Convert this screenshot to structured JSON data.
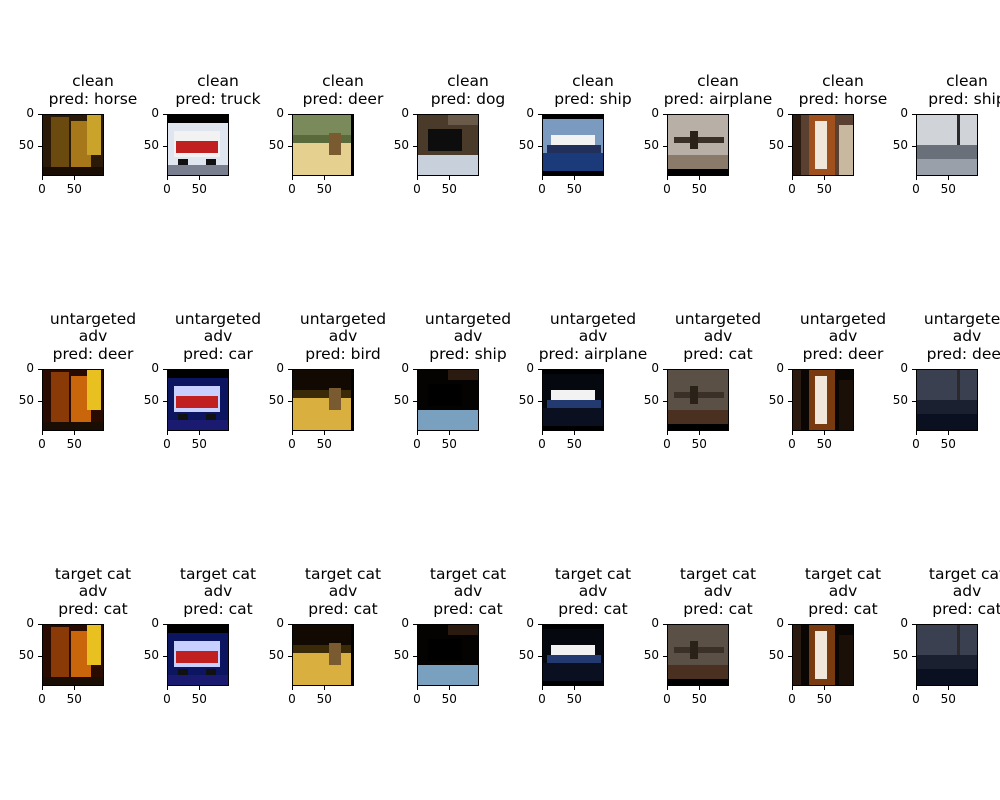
{
  "chart_data": {
    "type": "image-grid",
    "rows": [
      {
        "row_label": "clean",
        "panels": [
          {
            "title_lines": [
              "clean",
              "pred: horse"
            ],
            "image": "horse-dark"
          },
          {
            "title_lines": [
              "clean",
              "pred: truck"
            ],
            "image": "fire-truck"
          },
          {
            "title_lines": [
              "clean",
              "pred: deer"
            ],
            "image": "deer-field"
          },
          {
            "title_lines": [
              "clean",
              "pred: dog"
            ],
            "image": "black-dog"
          },
          {
            "title_lines": [
              "clean",
              "pred: ship"
            ],
            "image": "ship-sea"
          },
          {
            "title_lines": [
              "clean",
              "pred: airplane"
            ],
            "image": "airplane-runway"
          },
          {
            "title_lines": [
              "clean",
              "pred: horse"
            ],
            "image": "horse-face"
          },
          {
            "title_lines": [
              "clean",
              "pred: ship"
            ],
            "image": "ship-harbor"
          }
        ]
      },
      {
        "row_label": "untargeted adv",
        "panels": [
          {
            "title_lines": [
              "untargeted",
              "adv",
              "pred: deer"
            ],
            "image": "horse-dark"
          },
          {
            "title_lines": [
              "untargeted",
              "adv",
              "pred: car"
            ],
            "image": "fire-truck"
          },
          {
            "title_lines": [
              "untargeted",
              "adv",
              "pred: bird"
            ],
            "image": "deer-field"
          },
          {
            "title_lines": [
              "untargeted",
              "adv",
              "pred: ship"
            ],
            "image": "black-dog"
          },
          {
            "title_lines": [
              "untargeted",
              "adv",
              "pred: airplane"
            ],
            "image": "ship-sea"
          },
          {
            "title_lines": [
              "untargeted",
              "adv",
              "pred: cat"
            ],
            "image": "airplane-runway"
          },
          {
            "title_lines": [
              "untargeted",
              "adv",
              "pred: deer"
            ],
            "image": "horse-face"
          },
          {
            "title_lines": [
              "untargeted",
              "adv",
              "pred: deer"
            ],
            "image": "ship-harbor"
          }
        ]
      },
      {
        "row_label": "target cat adv",
        "panels": [
          {
            "title_lines": [
              "target cat",
              "adv",
              "pred: cat"
            ],
            "image": "horse-dark"
          },
          {
            "title_lines": [
              "target cat",
              "adv",
              "pred: cat"
            ],
            "image": "fire-truck"
          },
          {
            "title_lines": [
              "target cat",
              "adv",
              "pred: cat"
            ],
            "image": "deer-field"
          },
          {
            "title_lines": [
              "target cat",
              "adv",
              "pred: cat"
            ],
            "image": "black-dog"
          },
          {
            "title_lines": [
              "target cat",
              "adv",
              "pred: cat"
            ],
            "image": "ship-sea"
          },
          {
            "title_lines": [
              "target cat",
              "adv",
              "pred: cat"
            ],
            "image": "airplane-runway"
          },
          {
            "title_lines": [
              "target cat",
              "adv",
              "pred: cat"
            ],
            "image": "horse-face"
          },
          {
            "title_lines": [
              "target cat",
              "adv",
              "pred: cat"
            ],
            "image": "ship-harbor"
          }
        ]
      }
    ],
    "x_ticks": [
      "0",
      "50"
    ],
    "y_ticks": [
      "0",
      "50"
    ],
    "x_range": [
      0,
      96
    ],
    "y_range": [
      0,
      96
    ]
  }
}
